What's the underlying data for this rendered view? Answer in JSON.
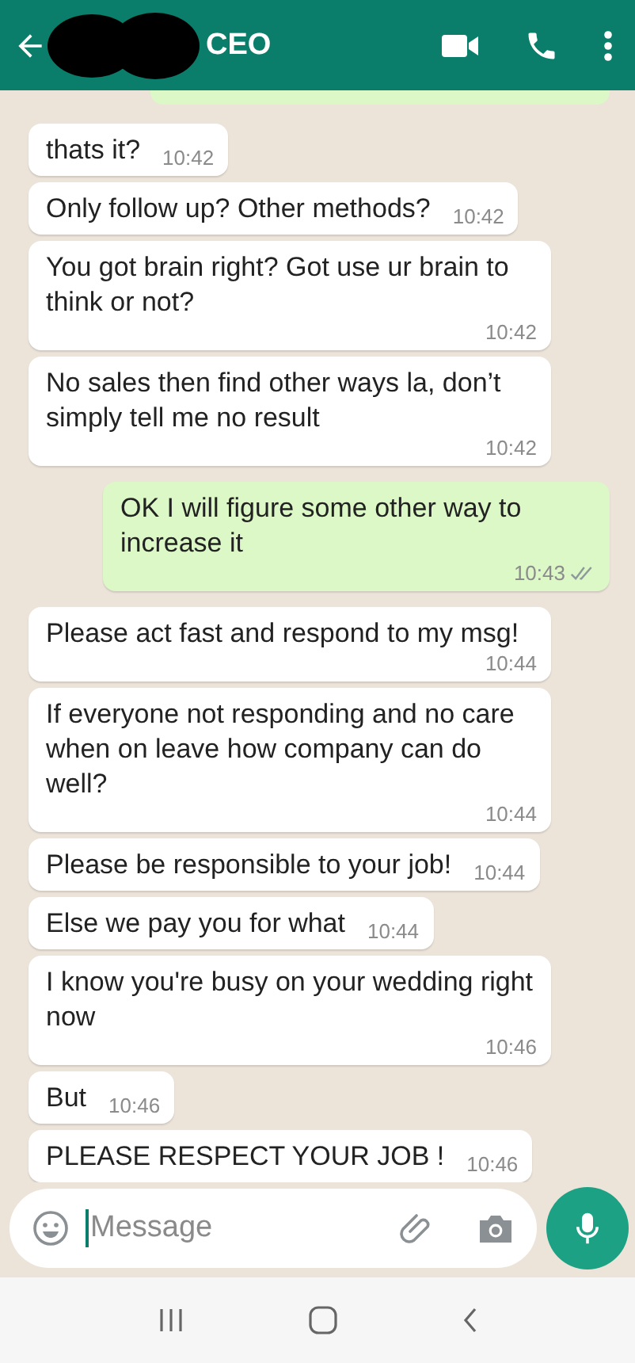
{
  "header": {
    "title": "CEO"
  },
  "messages": [
    {
      "kind": "in",
      "text": "thats it?",
      "time": "10:42"
    },
    {
      "kind": "in",
      "text": "Only follow up? Other methods?",
      "time": "10:42"
    },
    {
      "kind": "in",
      "text": "You got brain right? Got use ur brain to think or not?",
      "time": "10:42"
    },
    {
      "kind": "in",
      "text": "No sales then find other ways la, don’t simply tell me no result",
      "time": "10:42"
    },
    {
      "kind": "out",
      "text": "OK I will figure some other way to increase it",
      "time": "10:43"
    },
    {
      "kind": "in",
      "text": "Please act fast and respond to my msg!",
      "time": "10:44"
    },
    {
      "kind": "in",
      "text": "If everyone not responding and no care when on leave how company can do well?",
      "time": "10:44"
    },
    {
      "kind": "in",
      "text": "Please be responsible to your job!",
      "time": "10:44"
    },
    {
      "kind": "in",
      "text": "Else we pay you for what",
      "time": "10:44"
    },
    {
      "kind": "in",
      "text": "I know you're busy on your wedding right now",
      "time": "10:46"
    },
    {
      "kind": "in",
      "text": "But",
      "time": "10:46"
    },
    {
      "kind": "in",
      "text": "PLEASE RESPECT YOUR JOB !",
      "time": "10:46"
    }
  ],
  "composer": {
    "placeholder": "Message"
  }
}
